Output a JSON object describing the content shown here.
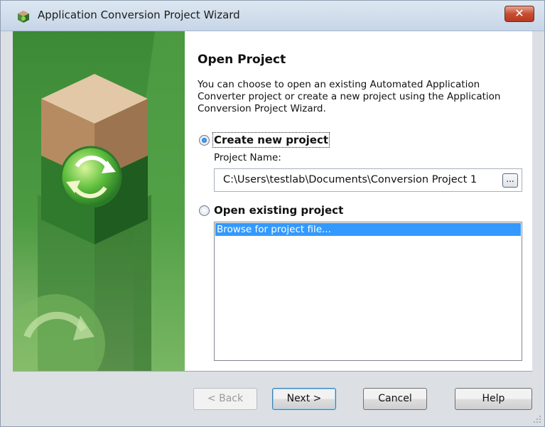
{
  "window": {
    "title": "Application Conversion Project Wizard",
    "close_label": "✕"
  },
  "page": {
    "heading": "Open Project",
    "description": "You can choose to open an existing Automated Application Converter project or create a new project using the Application Conversion Project Wizard."
  },
  "options": {
    "create": {
      "label": "Create new project",
      "selected": true
    },
    "project_name_label": "Project Name:",
    "project_path": "C:\\Users\\testlab\\Documents\\Conversion Project 1",
    "browse_button_label": "...",
    "open": {
      "label": "Open existing project",
      "selected": false
    },
    "list_items": [
      "Browse for project file..."
    ]
  },
  "buttons": {
    "back": "< Back",
    "next": "Next >",
    "cancel": "Cancel",
    "help": "Help"
  },
  "colors": {
    "accent_green": "#3f8f3a",
    "selection_blue": "#3399ff",
    "close_red": "#c64d33"
  }
}
